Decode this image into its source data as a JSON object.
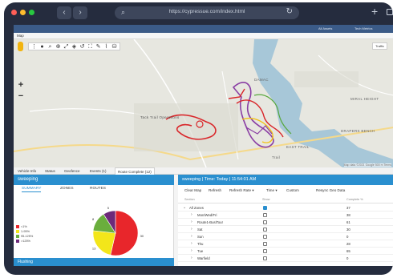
{
  "browser": {
    "url": "https://cypressue.com/index.html",
    "colors": {
      "close": "#ff5f57",
      "minimize": "#febc2e",
      "maximize": "#28c840"
    }
  },
  "app_header": {
    "items": [
      "All Assets",
      "Tech Metrics"
    ]
  },
  "map": {
    "selector_label": "Map",
    "traffic_label": "Traffic",
    "labels": [
      "Tack Trail Operations",
      "DAMAC",
      "MIRAL HEIGHT",
      "DRAPERS BENCH",
      "EAST TRAIL",
      "Trail"
    ],
    "attribution": "Map data ©2021 Google  500 m  Terms",
    "route_colors": [
      "#d9262a",
      "#f2c318",
      "#8a3ea4",
      "#58a83d"
    ]
  },
  "bottom_tabs": [
    "Vehicle Info",
    "Status",
    "Geofence",
    "Events (1)",
    "Route Complete (12)"
  ],
  "active_bottom_tab": "Route Complete (12)",
  "left_panel": {
    "title": "sweeping",
    "tabs": [
      "SUMMARY",
      "ZONES",
      "ROUTES"
    ],
    "active_tab": "SUMMARY",
    "footer": "Flushing"
  },
  "chart_data": {
    "type": "pie",
    "categories": [
      "<1%",
      "1-95%",
      "95-125%",
      ">125%"
    ],
    "values": [
      30,
      13,
      8,
      5
    ],
    "colors": [
      "#e8262b",
      "#f3e61a",
      "#6aae3d",
      "#6d2a7a"
    ]
  },
  "right_panel": {
    "title": "sweeping | Time: Today | 11:54:01 AM",
    "toolbar": [
      "Clear Map",
      "Refresh",
      "Refresh Rate ▾",
      "Time ▾",
      "Custom",
      "Resync Geo Data"
    ],
    "columns": [
      "Section",
      "Show",
      "Complete %"
    ],
    "rows": [
      {
        "name": "All Zones",
        "checked": true,
        "value": "37",
        "expanded": true
      },
      {
        "name": "Mon/Wed/Fri",
        "checked": false,
        "value": "38"
      },
      {
        "name": "Route1-BusiTour",
        "checked": false,
        "value": "61"
      },
      {
        "name": "Sat",
        "checked": false,
        "value": "30"
      },
      {
        "name": "Sun",
        "checked": false,
        "value": "0"
      },
      {
        "name": "Thu",
        "checked": false,
        "value": "28"
      },
      {
        "name": "Tue",
        "checked": false,
        "value": "65"
      },
      {
        "name": "Warfield",
        "checked": false,
        "value": "0"
      }
    ]
  }
}
